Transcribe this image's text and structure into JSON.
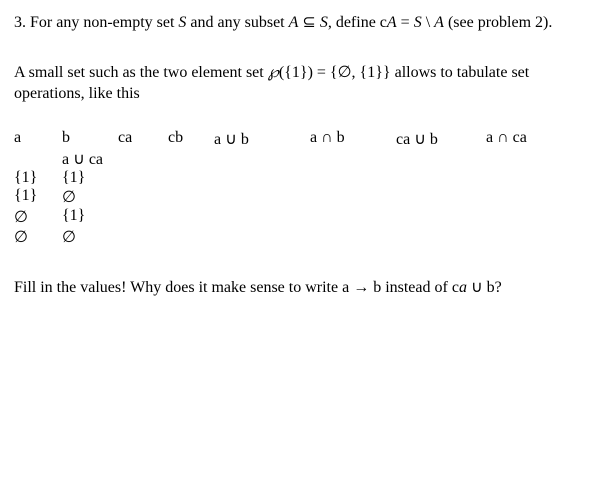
{
  "intro": {
    "number": "3.",
    "text1": " For any non-empty set ",
    "S": "S",
    "text2": " and any subset ",
    "A": "A",
    "subset": " ⊆ ",
    "S2": "S",
    "text3": ", define c",
    "A2": "A",
    "eq": " = ",
    "S3": "S",
    "setminus": " \\ ",
    "A3": "A",
    "text4": " (see problem 2)."
  },
  "desc": {
    "text1": "A small set such as the two element set ",
    "wp": "℘",
    "arg": "({1}) = {∅, {1}} allows to tabulate set operations, like this"
  },
  "headers": {
    "a": "a",
    "b": "b",
    "ca": "ca",
    "cb": "cb",
    "aub": "a ∪ b",
    "anb": "a ∩ b",
    "caub": "ca ∪ b",
    "anca": "a ∩ ca",
    "auca": "a ∪ ca"
  },
  "rows": [
    {
      "a": "{1}",
      "b": "{1}"
    },
    {
      "a": "{1}",
      "b": "∅"
    },
    {
      "a": "∅",
      "b": "{1}"
    },
    {
      "a": "∅",
      "b": "∅"
    }
  ],
  "question": {
    "text1": "Fill in the values! Why does it make sense to write a → b instead of c",
    "a": "a",
    "text2": " ∪ b?"
  }
}
